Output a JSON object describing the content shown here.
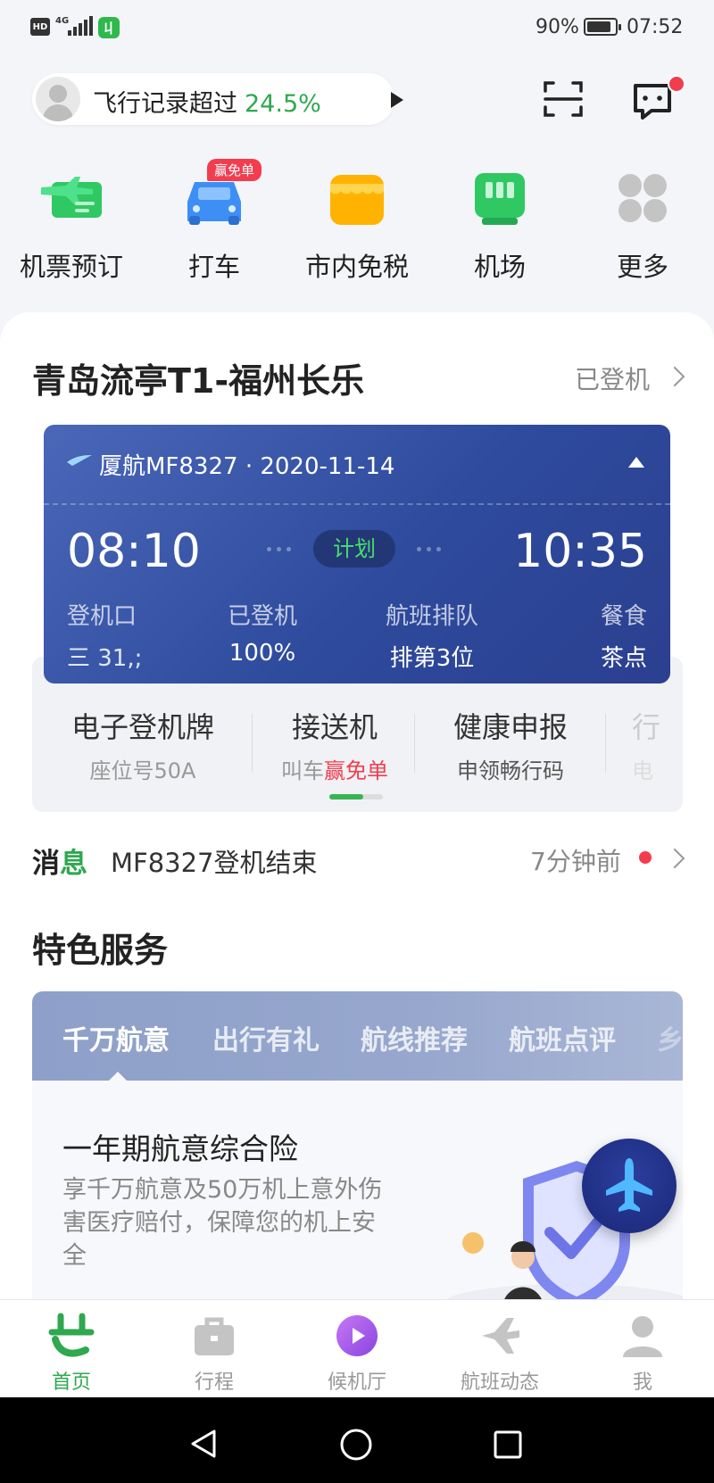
{
  "status_bar": {
    "hd": "HD",
    "network": "4G",
    "battery_text": "90%",
    "battery_level": 0.9,
    "time": "07:52",
    "app_icon": "app-logo-icon"
  },
  "header": {
    "record_prefix": "飞行记录超过",
    "record_percent": "24.5%",
    "scan_icon": "scan-icon",
    "message_icon": "message-icon",
    "message_has_unread": true
  },
  "quick_services": [
    {
      "label": "机票预订",
      "icon": "ticket-plane-icon",
      "color": "#2fc862"
    },
    {
      "label": "打车",
      "icon": "taxi-icon",
      "color": "#3d8ff5",
      "badge": "赢免单"
    },
    {
      "label": "市内免税",
      "icon": "shop-icon",
      "color": "#ffb300"
    },
    {
      "label": "机场",
      "icon": "airport-icon",
      "color": "#2fc862"
    },
    {
      "label": "更多",
      "icon": "more-grid-icon",
      "color": "#bdbdbd"
    }
  ],
  "trip": {
    "route": "青岛流亭T1-福州长乐",
    "status": "已登机",
    "flight_line": "厦航MF8327 · 2020-11-14",
    "dep_time": "08:10",
    "arr_time": "10:35",
    "plan_label": "计划",
    "info": [
      {
        "k": "登机口",
        "v": "三  31,;"
      },
      {
        "k": "已登机",
        "v": "100%"
      },
      {
        "k": "航班排队",
        "v": "排第3位"
      },
      {
        "k": "餐食",
        "v": "茶点"
      }
    ],
    "services": [
      {
        "title": "电子登机牌",
        "sub": "座位号50A"
      },
      {
        "title": "接送机",
        "sub_prefix": "叫车",
        "sub_highlight": "赢免单"
      },
      {
        "title": "健康申报",
        "sub": "申领畅行码"
      },
      {
        "title": "行",
        "sub": "电"
      }
    ]
  },
  "news": {
    "tag_a": "消",
    "tag_b": "息",
    "text": "MF8327登机结束",
    "time": "7分钟前"
  },
  "special": {
    "title": "特色服务",
    "tabs": [
      "千万航意",
      "出行有礼",
      "航线推荐",
      "航班点评",
      "乡"
    ],
    "active_tab": 0,
    "card_title": "一年期航意综合险",
    "card_desc": "享千万航意及50万机上意外伤害医疗赔付，保障您的机上安全"
  },
  "tabbar": [
    {
      "label": "首页",
      "icon": "home-logo-icon",
      "active": true
    },
    {
      "label": "行程",
      "icon": "briefcase-icon"
    },
    {
      "label": "候机厅",
      "icon": "play-circle-icon"
    },
    {
      "label": "航班动态",
      "icon": "plane-icon"
    },
    {
      "label": "我",
      "icon": "user-icon"
    }
  ],
  "colors": {
    "brand_green": "#2fa84f",
    "flight_card_blue": "#2e4b9d",
    "alert_red": "#f23d4f"
  }
}
